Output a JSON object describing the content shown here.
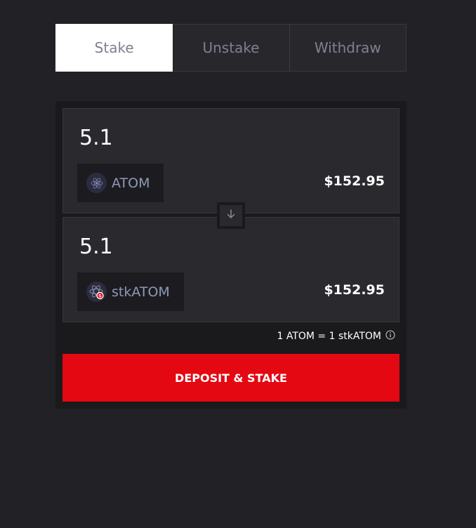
{
  "tabs": [
    {
      "label": "Stake",
      "active": true
    },
    {
      "label": "Unstake",
      "active": false
    },
    {
      "label": "Withdraw",
      "active": false
    }
  ],
  "from": {
    "amount": "5.1",
    "token": "ATOM",
    "token_icon": "cosmos-atom-icon",
    "usd_value": "$152.95"
  },
  "to": {
    "amount": "5.1",
    "token": "stkATOM",
    "token_icon": "stk-atom-icon",
    "usd_value": "$152.95"
  },
  "swap_icon": "arrow-down-icon",
  "exchange_rate": "1 ATOM = 1 stkATOM",
  "info_icon": "info-icon",
  "action_button": "DEPOSIT & STAKE",
  "colors": {
    "background": "#222126",
    "card": "#1a1a1d",
    "panel": "#2a292e",
    "accent": "#e30812",
    "token_text": "#8f98b6",
    "tab_text": "#7d8191"
  }
}
